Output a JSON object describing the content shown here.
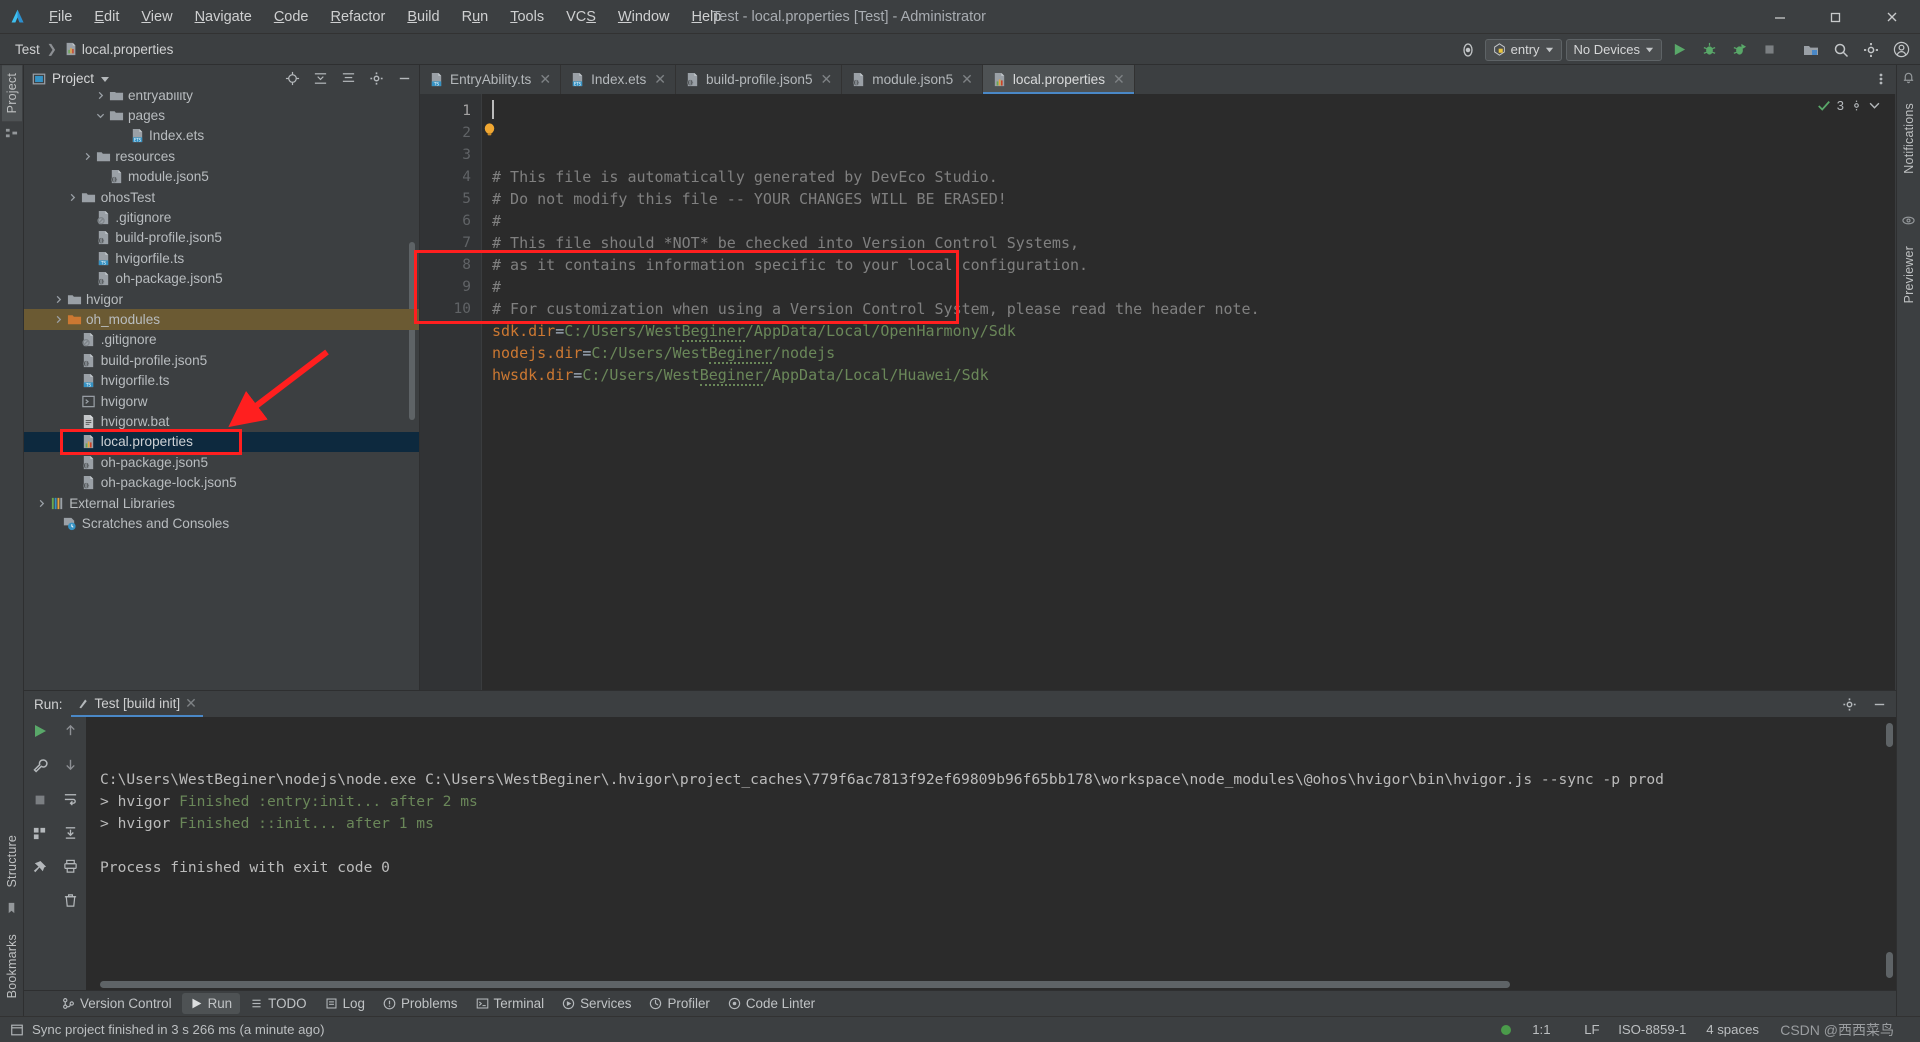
{
  "window": {
    "title": "Test - local.properties [Test] - Administrator",
    "logo_icon": "deveco-logo-icon",
    "minimize_icon": "minimize-icon",
    "restore_icon": "restore-icon",
    "close_icon": "close-icon"
  },
  "menubar": [
    {
      "label": "File",
      "mnemonic": "F"
    },
    {
      "label": "Edit",
      "mnemonic": "E"
    },
    {
      "label": "View",
      "mnemonic": "V"
    },
    {
      "label": "Navigate",
      "mnemonic": "N"
    },
    {
      "label": "Code",
      "mnemonic": "C"
    },
    {
      "label": "Refactor",
      "mnemonic": "R"
    },
    {
      "label": "Build",
      "mnemonic": "B"
    },
    {
      "label": "Run",
      "mnemonic": "R"
    },
    {
      "label": "Tools",
      "mnemonic": "T"
    },
    {
      "label": "VCS",
      "mnemonic": "S"
    },
    {
      "label": "Window",
      "mnemonic": "W"
    },
    {
      "label": "Help",
      "mnemonic": "H"
    }
  ],
  "navbar": {
    "breadcrumb": [
      "Test",
      "local.properties"
    ],
    "breadcrumb_file_icon": "properties-file-icon",
    "device_manager_icon": "device-manager-icon",
    "run_config": "entry",
    "run_config_icon": "module-icon",
    "device_selector": "No Devices",
    "buttons": [
      {
        "name": "run-button",
        "icon": "run-triangle-icon"
      },
      {
        "name": "debug-button",
        "icon": "debug-bug-icon"
      },
      {
        "name": "run-coverage-button",
        "icon": "coverage-bug-icon"
      },
      {
        "name": "stop-button",
        "icon": "stop-square-icon"
      },
      {
        "name": "device-file-browser-button",
        "icon": "folder-device-icon"
      },
      {
        "name": "search-everywhere-button",
        "icon": "search-icon"
      },
      {
        "name": "settings-button",
        "icon": "gear-icon"
      },
      {
        "name": "account-button",
        "icon": "account-icon"
      }
    ]
  },
  "left_stripe": {
    "tabs": [
      "Project",
      "Bookmarks",
      "Structure"
    ]
  },
  "right_stripe": {
    "tabs": [
      "Notifications",
      "Previewer"
    ]
  },
  "project_panel": {
    "title": "Project",
    "dropdown_icon": "chevron-down-icon",
    "toolbar": [
      {
        "name": "select-opened-file-button",
        "icon": "target-icon"
      },
      {
        "name": "expand-all-button",
        "icon": "expand-all-icon"
      },
      {
        "name": "collapse-all-button",
        "icon": "collapse-all-icon"
      },
      {
        "name": "settings-button",
        "icon": "gear-icon"
      },
      {
        "name": "hide-button",
        "icon": "minus-icon"
      }
    ],
    "tree": [
      {
        "label": "entryability",
        "indent": 3,
        "icon": "folder-icon",
        "twisty": "right",
        "state": "clipped"
      },
      {
        "label": "pages",
        "indent": 3,
        "icon": "folder-icon",
        "twisty": "down"
      },
      {
        "label": "Index.ets",
        "indent": 4,
        "icon": "ets-file-icon",
        "twisty": "none"
      },
      {
        "label": "resources",
        "indent": 2.4,
        "icon": "folder-icon",
        "twisty": "right"
      },
      {
        "label": "module.json5",
        "indent": 3,
        "icon": "json5-file-icon",
        "twisty": "none"
      },
      {
        "label": "ohosTest",
        "indent": 1.7,
        "icon": "folder-icon",
        "twisty": "right"
      },
      {
        "label": ".gitignore",
        "indent": 2.4,
        "icon": "gitignore-file-icon",
        "twisty": "none"
      },
      {
        "label": "build-profile.json5",
        "indent": 2.4,
        "icon": "json5-file-icon",
        "twisty": "none"
      },
      {
        "label": "hvigorfile.ts",
        "indent": 2.4,
        "icon": "ts-file-icon",
        "twisty": "none"
      },
      {
        "label": "oh-package.json5",
        "indent": 2.4,
        "icon": "json5-file-icon",
        "twisty": "none"
      },
      {
        "label": "hvigor",
        "indent": 1,
        "icon": "folder-icon",
        "twisty": "right"
      },
      {
        "label": "oh_modules",
        "indent": 1,
        "icon": "folder-orange-icon",
        "twisty": "right",
        "highlight": true
      },
      {
        "label": ".gitignore",
        "indent": 1.7,
        "icon": "gitignore-file-icon",
        "twisty": "none"
      },
      {
        "label": "build-profile.json5",
        "indent": 1.7,
        "icon": "json5-file-icon",
        "twisty": "none"
      },
      {
        "label": "hvigorfile.ts",
        "indent": 1.7,
        "icon": "ts-file-icon",
        "twisty": "none"
      },
      {
        "label": "hvigorw",
        "indent": 1.7,
        "icon": "script-file-icon",
        "twisty": "none"
      },
      {
        "label": "hvigorw.bat",
        "indent": 1.7,
        "icon": "bat-file-icon",
        "twisty": "none"
      },
      {
        "label": "local.properties",
        "indent": 1.7,
        "icon": "properties-file-icon",
        "twisty": "none",
        "selected": true,
        "annotated": true
      },
      {
        "label": "oh-package.json5",
        "indent": 1.7,
        "icon": "json5-file-icon",
        "twisty": "none"
      },
      {
        "label": "oh-package-lock.json5",
        "indent": 1.7,
        "icon": "json5-file-icon",
        "twisty": "none"
      },
      {
        "label": "External Libraries",
        "indent": 0.2,
        "icon": "libraries-icon",
        "twisty": "right"
      },
      {
        "label": "Scratches and Consoles",
        "indent": 0.8,
        "icon": "scratches-icon",
        "twisty": "none"
      }
    ]
  },
  "editor": {
    "tabs": [
      {
        "label": "EntryAbility.ts",
        "icon": "ts-file-icon",
        "active": false
      },
      {
        "label": "Index.ets",
        "icon": "ets-file-icon",
        "active": false
      },
      {
        "label": "build-profile.json5",
        "icon": "json5-file-icon",
        "active": false
      },
      {
        "label": "module.json5",
        "icon": "json5-file-icon",
        "active": false
      },
      {
        "label": "local.properties",
        "icon": "properties-file-icon",
        "active": true
      }
    ],
    "inspection_count": "3",
    "inspection_icon": "checkmark-icon",
    "lines": [
      {
        "n": "1",
        "type": "comment",
        "text": "# This file is automatically generated by DevEco Studio."
      },
      {
        "n": "2",
        "type": "comment",
        "text": "# Do not modify this file -- YOUR CHANGES WILL BE ERASED!"
      },
      {
        "n": "3",
        "type": "comment",
        "text": "#"
      },
      {
        "n": "4",
        "type": "comment",
        "text": "# This file should *NOT* be checked into Version Control Systems,"
      },
      {
        "n": "5",
        "type": "comment",
        "text": "# as it contains information specific to your local configuration."
      },
      {
        "n": "6",
        "type": "comment",
        "text": "#"
      },
      {
        "n": "7",
        "type": "comment",
        "text": "# For customization when using a Version Control System, please read the header note."
      },
      {
        "n": "8",
        "type": "prop",
        "key": "sdk.dir",
        "eq": "=",
        "val_pre": "C:/Users/West",
        "val_squig": "Beginer",
        "val_post": "/AppData/Local/OpenHarmony/Sdk"
      },
      {
        "n": "9",
        "type": "prop",
        "key": "nodejs.dir",
        "eq": "=",
        "val_pre": "C:/Users/West",
        "val_squig": "Beginer",
        "val_post": "/nodejs"
      },
      {
        "n": "10",
        "type": "prop",
        "key": "hwsdk.dir",
        "eq": "=",
        "val_pre": "C:/Users/West",
        "val_squig": "Beginer",
        "val_post": "/AppData/Local/Huawei/Sdk"
      }
    ]
  },
  "run_panel": {
    "label": "Run:",
    "tab": "Test [build init]",
    "tab_icon": "build-init-icon",
    "close_icon": "close-icon",
    "settings_icon": "gear-icon",
    "hide_icon": "minus-icon",
    "side_buttons": [
      {
        "name": "rerun-button",
        "icon": "run-triangle-icon"
      },
      {
        "name": "scroll-up-button",
        "icon": "arrow-up-icon"
      },
      {
        "name": "stop-button",
        "icon": "stop-square-icon"
      },
      {
        "name": "wrench-button",
        "icon": "wrench-icon"
      },
      {
        "name": "soft-wrap-button",
        "icon": "soft-wrap-icon"
      },
      {
        "name": "scroll-to-end-button",
        "icon": "scroll-end-icon"
      },
      {
        "name": "print-button",
        "icon": "printer-icon"
      },
      {
        "name": "clear-all-button",
        "icon": "trash-icon"
      }
    ],
    "console": [
      {
        "type": "white",
        "text": "C:\\Users\\WestBeginer\\nodejs\\node.exe C:\\Users\\WestBeginer\\.hvigor\\project_caches\\779f6ac7813f92ef69809b96f65bb178\\workspace\\node_modules\\@ohos\\hvigor\\bin\\hvigor.js --sync -p prod"
      },
      {
        "type": "mixed",
        "prefix": "> hvigor ",
        "green": "Finished :entry:init... after 2 ms"
      },
      {
        "type": "mixed",
        "prefix": "> hvigor ",
        "green": "Finished ::init... after 1 ms"
      },
      {
        "type": "blank",
        "text": ""
      },
      {
        "type": "white",
        "text": "Process finished with exit code 0"
      }
    ]
  },
  "toolwindow_bar": [
    {
      "label": "Version Control",
      "icon": "version-control-icon",
      "active": false
    },
    {
      "label": "Run",
      "icon": "run-triangle-icon",
      "active": true
    },
    {
      "label": "TODO",
      "icon": "todo-icon",
      "active": false
    },
    {
      "label": "Log",
      "icon": "log-icon",
      "active": false
    },
    {
      "label": "Problems",
      "icon": "problems-icon",
      "active": false
    },
    {
      "label": "Terminal",
      "icon": "terminal-icon",
      "active": false
    },
    {
      "label": "Services",
      "icon": "services-icon",
      "active": false
    },
    {
      "label": "Profiler",
      "icon": "profiler-icon",
      "active": false
    },
    {
      "label": "Code Linter",
      "icon": "code-linter-icon",
      "active": false
    }
  ],
  "statusbar": {
    "icon": "event-log-icon",
    "message": "Sync project finished in 3 s 266 ms (a minute ago)",
    "caret_position": "1:1",
    "line_separator": "LF",
    "encoding": "ISO-8859-1",
    "indent": "4 spaces",
    "status_dot_color": "#4a9b4a",
    "watermark": "CSDN @西西菜鸟"
  },
  "colors": {
    "accent_blue": "#4a88c7",
    "annotation_red": "#ff1f1f",
    "selection_navy": "#0d293e",
    "code_key_orange": "#cc7832",
    "code_value_green": "#6a8759",
    "comment_gray": "#808080"
  }
}
